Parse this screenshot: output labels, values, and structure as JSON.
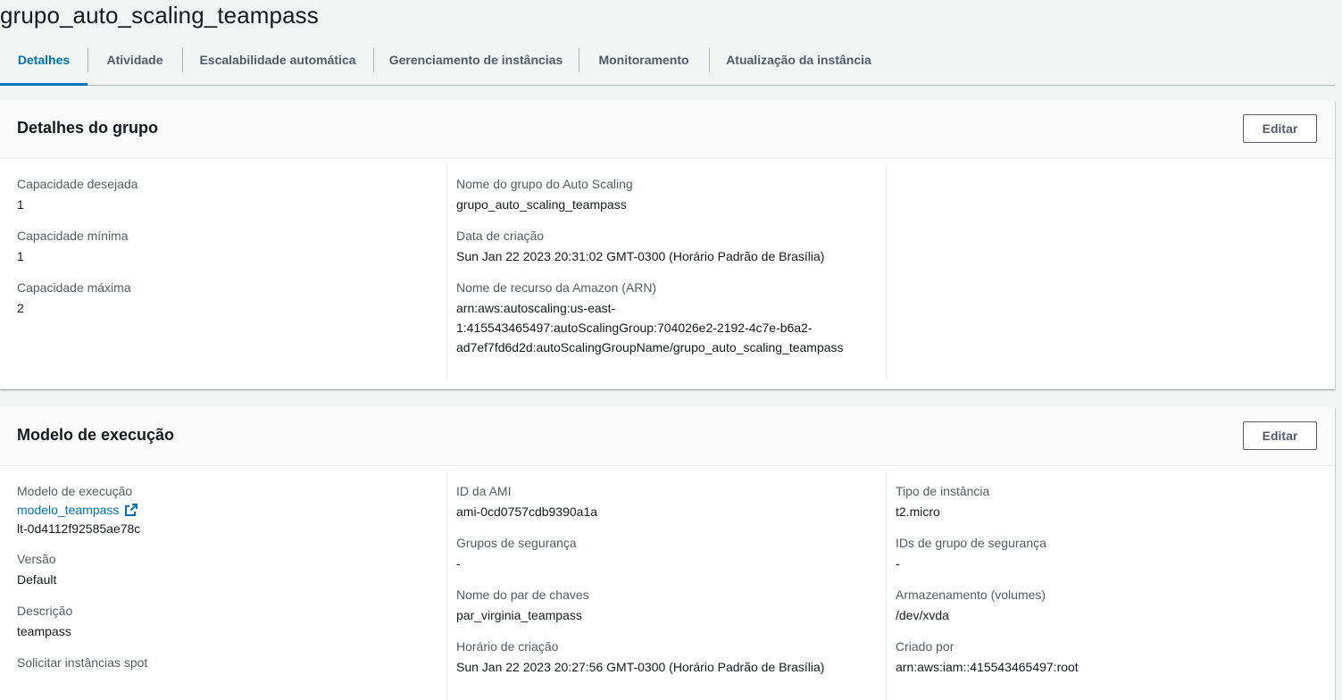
{
  "page": {
    "title": "grupo_auto_scaling_teampass"
  },
  "tabs": [
    {
      "label": "Detalhes"
    },
    {
      "label": "Atividade"
    },
    {
      "label": "Escalabilidade automática"
    },
    {
      "label": "Gerenciamento de instâncias"
    },
    {
      "label": "Monitoramento"
    },
    {
      "label": "Atualização da instância"
    }
  ],
  "group_details": {
    "title": "Detalhes do grupo",
    "edit_label": "Editar",
    "desired_capacity": {
      "label": "Capacidade desejada",
      "value": "1"
    },
    "min_capacity": {
      "label": "Capacidade mínima",
      "value": "1"
    },
    "max_capacity": {
      "label": "Capacidade máxima",
      "value": "2"
    },
    "group_name": {
      "label": "Nome do grupo do Auto Scaling",
      "value": "grupo_auto_scaling_teampass"
    },
    "creation_date": {
      "label": "Data de criação",
      "value": "Sun Jan 22 2023 20:31:02 GMT-0300 (Horário Padrão de Brasília)"
    },
    "arn": {
      "label": "Nome de recurso da Amazon (ARN)",
      "line1": "arn:aws:autoscaling:us-east-",
      "line2": "1:415543465497:autoScalingGroup:704026e2-2192-4c7e-b6a2-",
      "line3": "ad7ef7fd6d2d:autoScalingGroupName/grupo_auto_scaling_teampass"
    }
  },
  "launch_template": {
    "title": "Modelo de execução",
    "edit_label": "Editar",
    "template": {
      "label": "Modelo de execução",
      "link": "modelo_teampass",
      "id": "lt-0d4112f92585ae78c"
    },
    "version": {
      "label": "Versão",
      "value": "Default"
    },
    "description": {
      "label": "Descrição",
      "value": "teampass"
    },
    "spot": {
      "label": "Solicitar instâncias spot"
    },
    "ami_id": {
      "label": "ID da AMI",
      "value": "ami-0cd0757cdb9390a1a"
    },
    "security_groups": {
      "label": "Grupos de segurança",
      "value": "-"
    },
    "key_pair": {
      "label": "Nome do par de chaves",
      "value": "par_virginia_teampass"
    },
    "created_time": {
      "label": "Horário de criação",
      "value": "Sun Jan 22 2023 20:27:56 GMT-0300 (Horário Padrão de Brasília)"
    },
    "instance_type": {
      "label": "Tipo de instância",
      "value": "t2.micro"
    },
    "security_group_ids": {
      "label": "IDs de grupo de segurança",
      "value": "-"
    },
    "storage": {
      "label": "Armazenamento (volumes)",
      "value": "/dev/xvda"
    },
    "created_by": {
      "label": "Criado por",
      "value": "arn:aws:iam::415543465497:root"
    }
  },
  "colors": {
    "accent": "#0073bb",
    "text": "#16191f",
    "label": "#545b64",
    "background": "#f2f3f3"
  },
  "icons": {
    "external_link": "external-link-icon"
  }
}
